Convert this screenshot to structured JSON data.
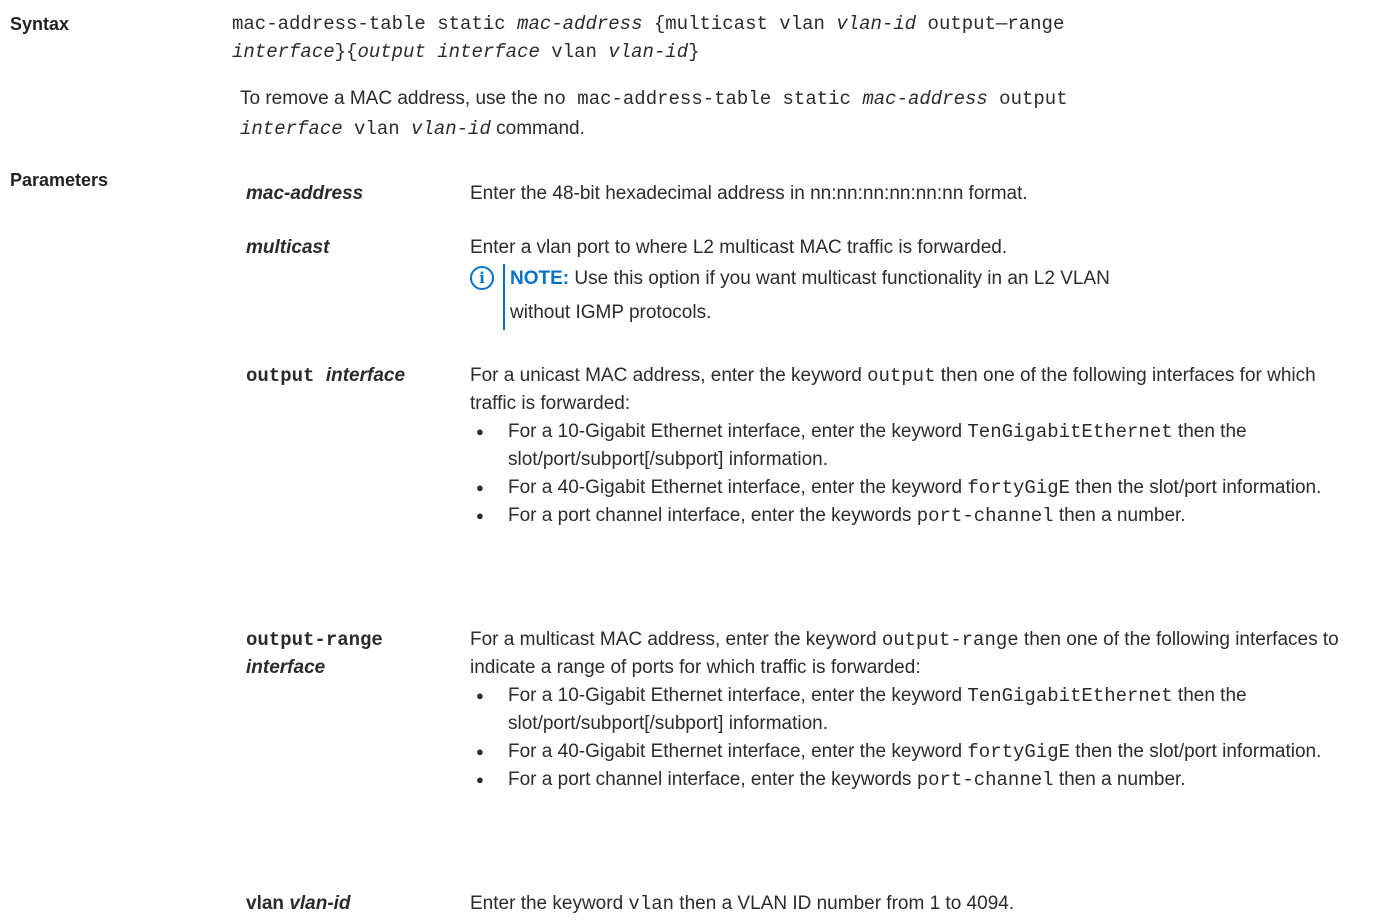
{
  "labels": {
    "syntax": "Syntax",
    "parameters": "Parameters"
  },
  "syntax": {
    "line1_a": "mac-address-table static ",
    "line1_b": "mac-address",
    "line1_c": " {multicast vlan ",
    "line1_d": "vlan-id",
    "line1_e": " output—range",
    "line2_a": "interface",
    "line2_b": "}{",
    "line2_c": "output interface",
    "line2_d": " vlan ",
    "line2_e": "vlan-id",
    "line2_f": "}"
  },
  "remove": {
    "intro": "To remove a MAC address, use the ",
    "code1": "no mac-address-table static ",
    "code1_it": "mac-address",
    "code2": " output",
    "code3_it": "interface",
    "code4": " vlan ",
    "code5_it": "vlan-id",
    "outro": " command."
  },
  "params": {
    "mac": {
      "name": "mac-address",
      "desc": "Enter the 48-bit hexadecimal address in nn:nn:nn:nn:nn:nn format."
    },
    "multicast": {
      "name": "multicast",
      "desc": "Enter a vlan port to where L2 multicast MAC traffic is forwarded.",
      "note_label": "NOTE:",
      "note_line1": " Use this option if you want multicast functionality in an L2 VLAN",
      "note_line2": "without IGMP protocols."
    },
    "output": {
      "name_mono": "output ",
      "name_it": "interface",
      "desc_a": "For a unicast MAC address, enter the keyword ",
      "desc_code": "output",
      "desc_b": " then one of the following interfaces for which traffic is forwarded:",
      "b1_a": "For a 10-Gigabit Ethernet interface, enter the keyword ",
      "b1_code": "TenGigabitEthernet",
      "b1_b": " then the slot/port/subport[/subport] information.",
      "b2_a": "For a 40-Gigabit Ethernet interface, enter the keyword ",
      "b2_code": "fortyGigE",
      "b2_b": " then the slot/port information.",
      "b3_a": "For a port channel interface, enter the keywords ",
      "b3_code": "port-channel",
      "b3_b": " then a number."
    },
    "output_range": {
      "name_mono": "output-range",
      "name_it": "interface",
      "desc_a": "For a multicast MAC address, enter the keyword ",
      "desc_code": "output-range",
      "desc_b": " then one of the following interfaces to indicate a range of ports for which traffic is forwarded:",
      "b1_a": "For a 10-Gigabit Ethernet interface, enter the keyword ",
      "b1_code": "TenGigabitEthernet",
      "b1_b": " then the slot/port/subport[/subport] information.",
      "b2_a": "For a 40-Gigabit Ethernet interface, enter the keyword ",
      "b2_code": "fortyGigE",
      "b2_b": " then the slot/port information.",
      "b3_a": "For a port channel interface, enter the keywords ",
      "b3_code": "port-channel",
      "b3_b": " then a number."
    },
    "vlan": {
      "name_a": "vlan ",
      "name_it": "vlan-id",
      "desc_a": "Enter the keyword ",
      "desc_code": "vlan",
      "desc_b": " then a VLAN ID number from 1 to 4094."
    }
  },
  "colors": {
    "accent": "#0672cb",
    "text": "#2b2b2b"
  }
}
